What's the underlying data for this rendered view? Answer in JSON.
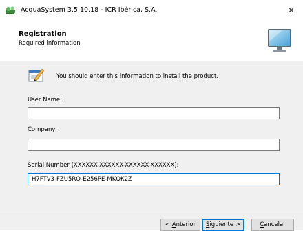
{
  "window": {
    "title": "AcquaSystem 3.5.10.18 - ICR Ibérica, S.A.",
    "close_glyph": "✕"
  },
  "header": {
    "title": "Registration",
    "subtitle": "Required information",
    "icon": "monitor-icon"
  },
  "content": {
    "info_text": "You should enter this information to install the product.",
    "info_icon": "pencil-document-icon",
    "user_name": {
      "label": "User Name:",
      "value": ""
    },
    "company": {
      "label": "Company:",
      "value": ""
    },
    "serial": {
      "label": "Serial Number (XXXXXX-XXXXXX-XXXXXX-XXXXXX):",
      "value": "H7FTV3-FZU5RQ-E256PE-MKQK2Z"
    }
  },
  "buttons": {
    "back": {
      "accel": "A",
      "rest": "nterior",
      "prefix": "< "
    },
    "next": {
      "accel": "S",
      "rest": "iguiente >"
    },
    "cancel": {
      "accel": "C",
      "rest": "ancelar"
    }
  },
  "colors": {
    "focus_border": "#0078d7",
    "panel_bg": "#f0f0f0"
  }
}
